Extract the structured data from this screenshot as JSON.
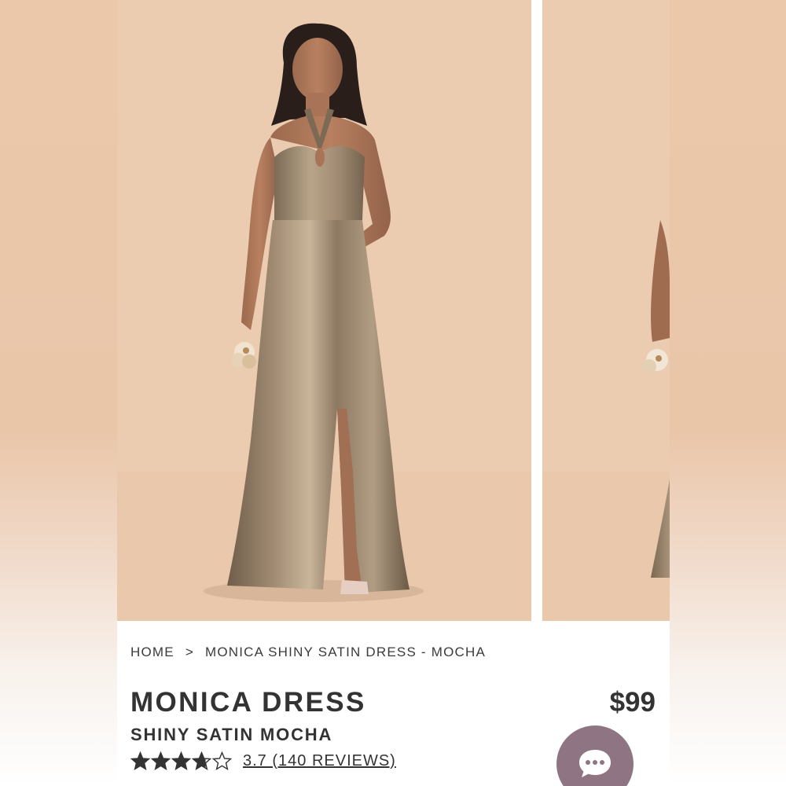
{
  "breadcrumb": {
    "home": "HOME",
    "separator": ">",
    "current": "MONICA SHINY SATIN DRESS - MOCHA"
  },
  "product": {
    "name": "MONICA DRESS",
    "variant": "SHINY SATIN MOCHA",
    "price": "$99"
  },
  "rating": {
    "value": 3.7,
    "max": 5,
    "reviews_text": "3.7 (140 REVIEWS)"
  },
  "gallery": {
    "images": [
      {
        "description_icon": "model-photo",
        "dress_color": "#8a7660"
      },
      {
        "description_icon": "model-photo",
        "dress_color": "#8a7660"
      }
    ]
  },
  "colors": {
    "backdrop": "#ecccb0",
    "dress": "#8a7660",
    "text": "#333333",
    "chat_button": "#8f7583"
  },
  "icons": {
    "chat": "chat-bubble-icon",
    "star": "star-icon"
  }
}
